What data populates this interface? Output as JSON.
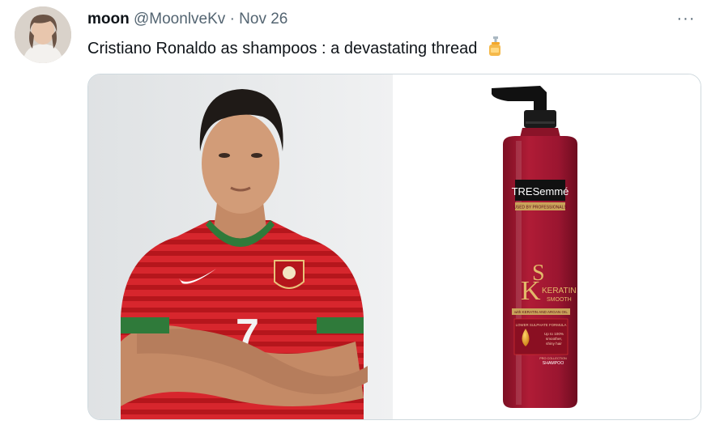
{
  "tweet": {
    "author_name": "moon",
    "author_handle": "@MoonlveKv",
    "separator": "·",
    "date": "Nov 26",
    "text": "Cristiano Ronaldo as shampoos : a devastating thread",
    "more_label": "···"
  },
  "product": {
    "brand": "TRESemmé",
    "tagline": "USED BY PROFESSIONALS",
    "line": "KERATIN",
    "line2": "SMOOTH",
    "ingredient": "with KERATIN AND ARGAN OIL",
    "formula": "LOWER SULPHATE FORMULA",
    "claim1": "Up to 100%",
    "claim2": "smoother,",
    "claim3": "shiny hair",
    "collection": "PRO COLLECTION",
    "type": "SHAMPOO"
  },
  "jersey": {
    "number": "7"
  }
}
